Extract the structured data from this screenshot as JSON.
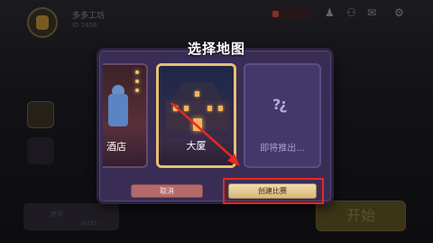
{
  "dialog": {
    "title": "选择地图",
    "maps": [
      {
        "label": "酒店"
      },
      {
        "label": "大厦"
      },
      {
        "label": "即将推出..."
      }
    ],
    "cancel_label": "取消",
    "create_label": "创建比赛"
  },
  "background": {
    "player_name": "多多工坊",
    "player_sub": "ID 1456",
    "start_label": "开始",
    "room_label": "房间",
    "room_count": "0/233"
  },
  "colors": {
    "dialog_bg": "#3a2d55",
    "selected_border": "#e6c074",
    "annotation_red": "#e8281f"
  }
}
